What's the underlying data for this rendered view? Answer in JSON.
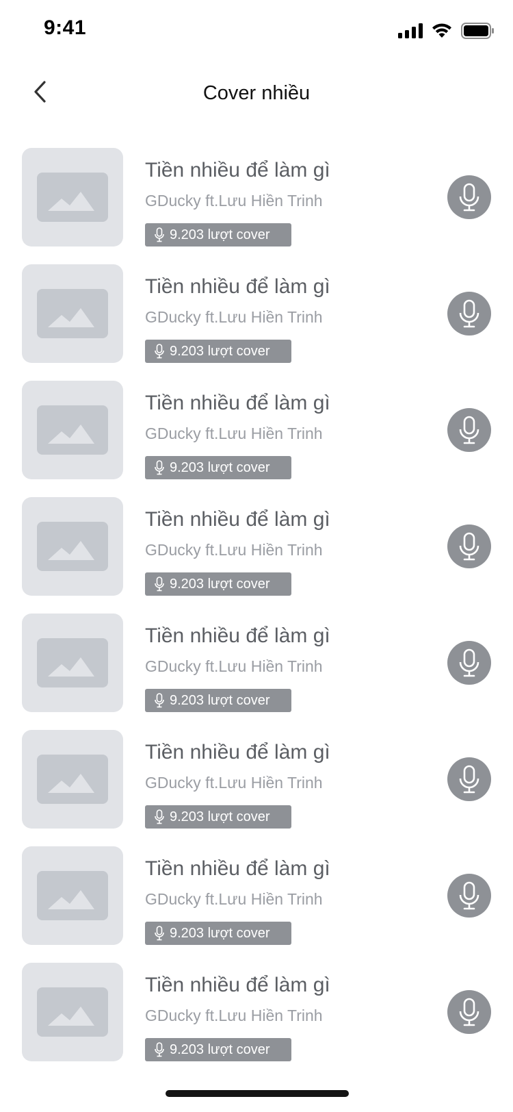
{
  "status_bar": {
    "time": "9:41"
  },
  "header": {
    "title": "Cover nhiều"
  },
  "songs": [
    {
      "title": "Tiền nhiều để làm gì",
      "artist": "GDucky ft.Lưu Hiền Trinh",
      "cover_count": "9.203 lượt cover"
    },
    {
      "title": "Tiền nhiều để làm gì",
      "artist": "GDucky ft.Lưu Hiền Trinh",
      "cover_count": "9.203 lượt cover"
    },
    {
      "title": "Tiền nhiều để làm gì",
      "artist": "GDucky ft.Lưu Hiền Trinh",
      "cover_count": "9.203 lượt cover"
    },
    {
      "title": "Tiền nhiều để làm gì",
      "artist": "GDucky ft.Lưu Hiền Trinh",
      "cover_count": "9.203 lượt cover"
    },
    {
      "title": "Tiền nhiều để làm gì",
      "artist": "GDucky ft.Lưu Hiền Trinh",
      "cover_count": "9.203 lượt cover"
    },
    {
      "title": "Tiền nhiều để làm gì",
      "artist": "GDucky ft.Lưu Hiền Trinh",
      "cover_count": "9.203 lượt cover"
    },
    {
      "title": "Tiền nhiều để làm gì",
      "artist": "GDucky ft.Lưu Hiền Trinh",
      "cover_count": "9.203 lượt cover"
    },
    {
      "title": "Tiền nhiều để làm gì",
      "artist": "GDucky ft.Lưu Hiền Trinh",
      "cover_count": "9.203 lượt cover"
    }
  ],
  "icons": {
    "back": "chevron-left-icon",
    "record": "microphone-icon",
    "thumbnail": "image-placeholder-icon"
  },
  "colors": {
    "title_text": "#5b5e63",
    "subtitle_text": "#9a9da3",
    "badge_bg": "#8e9196",
    "thumb_bg": "#e1e3e7"
  }
}
